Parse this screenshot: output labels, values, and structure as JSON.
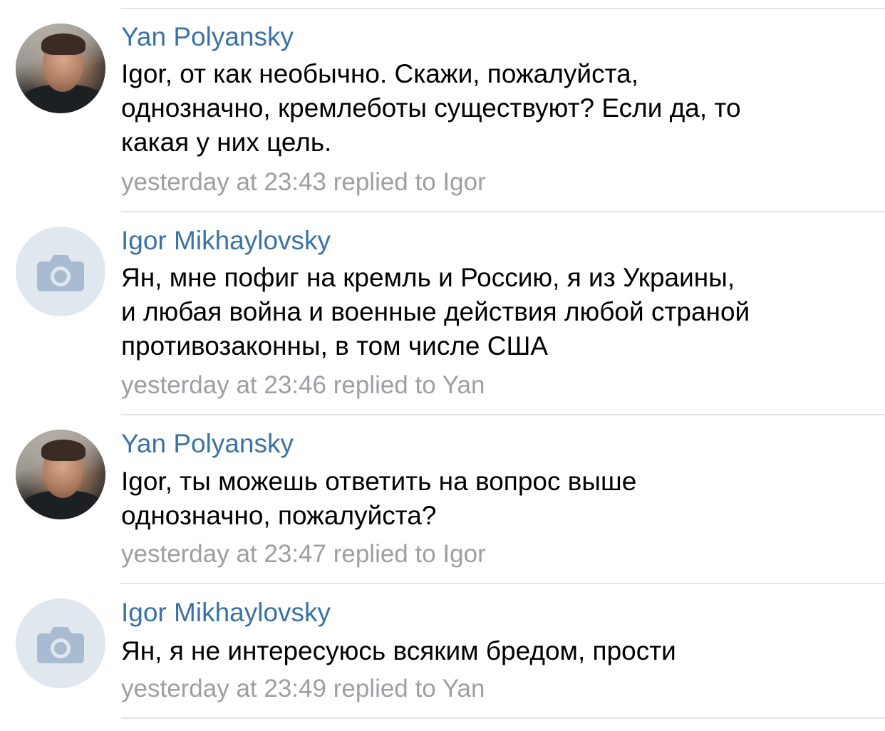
{
  "comments": [
    {
      "author": "Yan Polyansky",
      "avatar": "user-photo",
      "lines": [
        "Igor, от как необычно. Скажи, пожалуйста,",
        "однозначно, кремлеботы существуют? Если да, то",
        "какая у них цель."
      ],
      "time": "yesterday at 23:43",
      "reply": "replied to Igor"
    },
    {
      "author": "Igor Mikhaylovsky",
      "avatar": "camera-icon",
      "lines": [
        "Ян, мне пофиг на кремль и Россию, я из Украины,",
        "и любая война и военные действия любой страной",
        "противозаконны, в том числе США"
      ],
      "time": "yesterday at 23:46",
      "reply": "replied to Yan"
    },
    {
      "author": "Yan Polyansky",
      "avatar": "user-photo",
      "lines": [
        "Igor, ты можешь ответить на вопрос выше",
        "однозначно, пожалуйста?"
      ],
      "time": "yesterday at 23:47",
      "reply": "replied to Igor"
    },
    {
      "author": "Igor Mikhaylovsky",
      "avatar": "camera-icon",
      "lines": [
        "Ян, я не интересуюсь всяким бредом, прости"
      ],
      "time": "yesterday at 23:49",
      "reply": "replied to Yan"
    }
  ],
  "colors": {
    "author_link": "#3a72a4",
    "meta_text": "#9e9ea3",
    "body_text": "#000000",
    "separator": "#e4e4e6",
    "placeholder_avatar_bg": "#e1e7ef",
    "placeholder_icon": "#a9bbd0"
  }
}
